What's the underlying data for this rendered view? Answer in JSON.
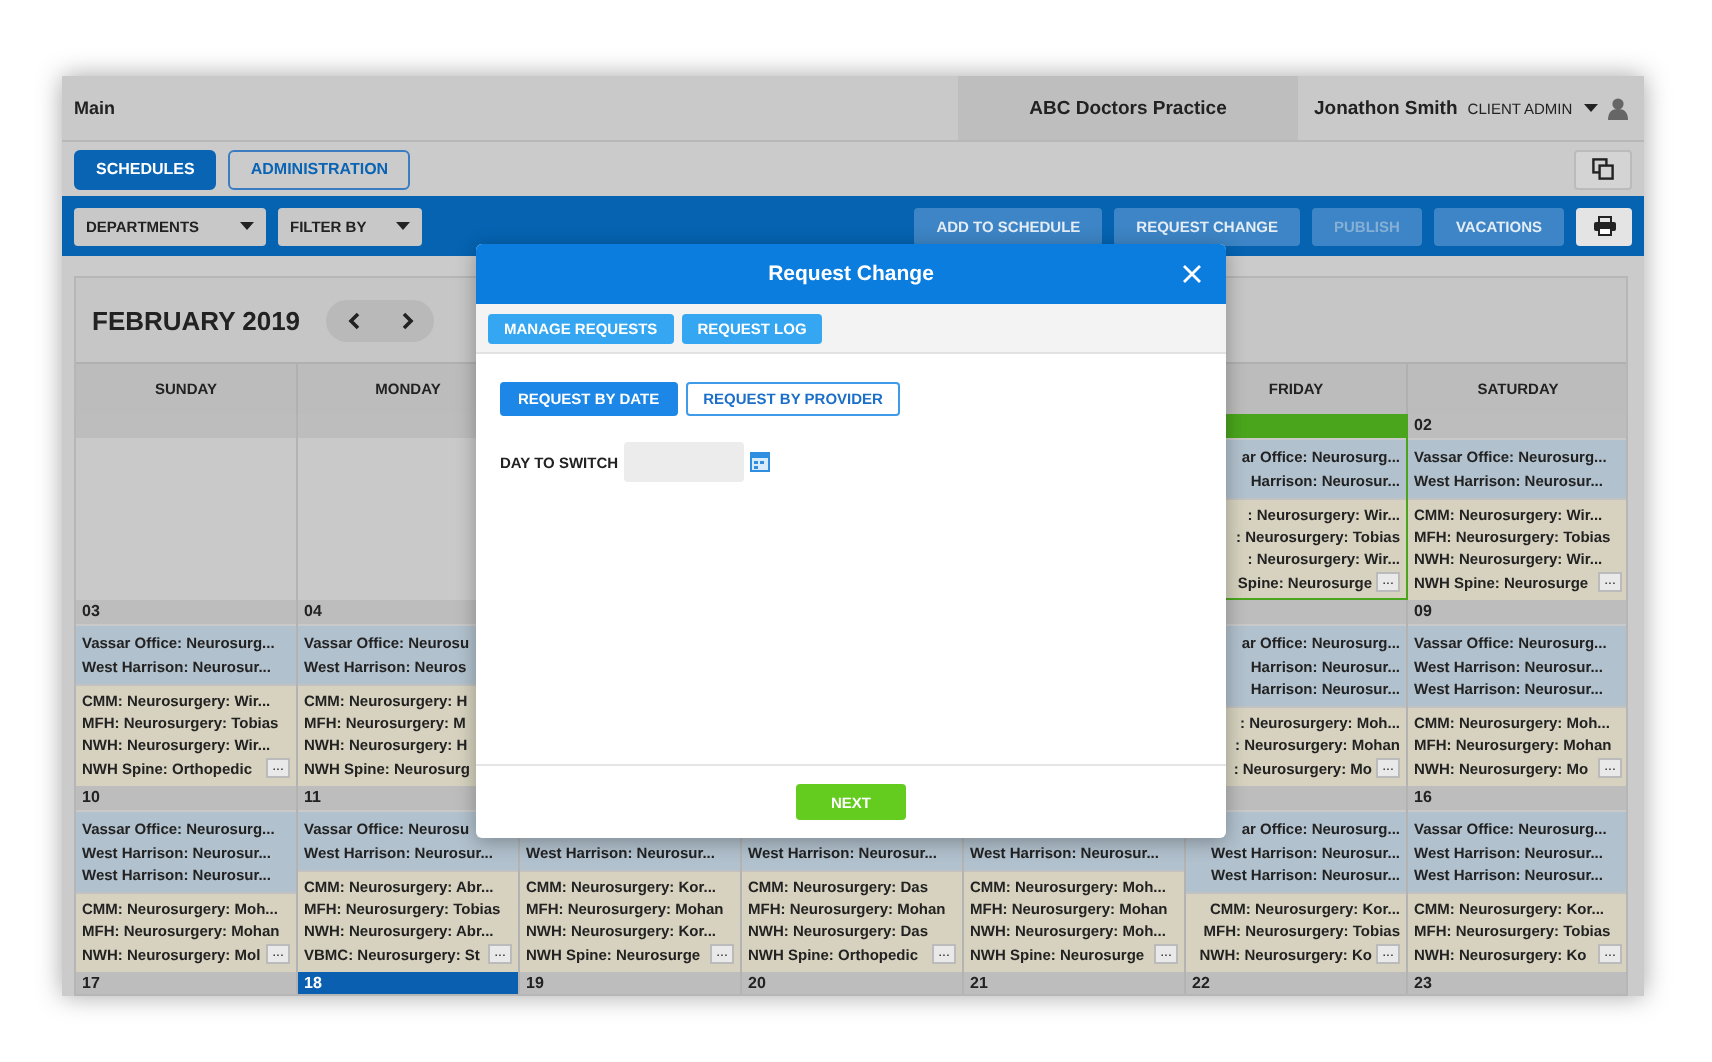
{
  "header": {
    "title": "Main",
    "practice": "ABC Doctors Practice",
    "user": "Jonathon Smith",
    "role": "CLIENT ADMIN"
  },
  "tabs": [
    {
      "label": "SCHEDULES",
      "selected": true
    },
    {
      "label": "ADMINISTRATION",
      "selected": false
    }
  ],
  "toolbar": {
    "filters": [
      "DEPARTMENTS",
      "FILTER BY"
    ],
    "actions": [
      {
        "label": "ADD TO SCHEDULE",
        "disabled": false
      },
      {
        "label": "REQUEST CHANGE",
        "disabled": false
      },
      {
        "label": "PUBLISH",
        "disabled": true
      },
      {
        "label": "VACATIONS",
        "disabled": false
      }
    ]
  },
  "calendar": {
    "month": "FEBRUARY 2019",
    "columns": [
      {
        "weekday": "SUNDAY",
        "days": [
          {
            "selected": false,
            "today": false
          },
          {
            "date": "03",
            "selected": false,
            "today": false,
            "blocks": [
              {
                "kind": "office",
                "lines": [
                  "Vassar Office: Neurosurg...",
                  "West Harrison: Neurosur..."
                ]
              },
              {
                "kind": "hospital",
                "lines": [
                  "CMM: Neurosurgery: Wir...",
                  "MFH: Neurosurgery: Tobias",
                  "NWH: Neurosurgery: Wir...",
                  "NWH Spine: Orthopedic"
                ],
                "more": "..."
              }
            ]
          },
          {
            "date": "10",
            "selected": false,
            "today": false,
            "blocks": [
              {
                "kind": "office",
                "lines": [
                  "Vassar Office: Neurosurg...",
                  "West Harrison: Neurosur...",
                  "West Harrison: Neurosur..."
                ]
              },
              {
                "kind": "hospital",
                "lines": [
                  "CMM: Neurosurgery: Moh...",
                  "MFH: Neurosurgery: Mohan",
                  "NWH: Neurosurgery: Mol"
                ],
                "more": "..."
              }
            ]
          },
          {
            "date": "17",
            "selected": false,
            "today": false
          }
        ]
      },
      {
        "weekday": "MONDAY",
        "days": [
          {
            "selected": false,
            "today": false
          },
          {
            "date": "04",
            "selected": false,
            "today": false,
            "blocks": [
              {
                "kind": "office",
                "lines": [
                  "Vassar Office: Neurosu",
                  "West Harrison: Neuros"
                ]
              },
              {
                "kind": "hospital",
                "lines": [
                  "CMM: Neurosurgery: H",
                  "MFH: Neurosurgery: M",
                  "NWH: Neurosurgery: H",
                  "NWH Spine: Neurosurg"
                ]
              }
            ]
          },
          {
            "date": "11",
            "selected": false,
            "today": false,
            "blocks": [
              {
                "kind": "office",
                "lines": [
                  "Vassar Office: Neurosu",
                  "West Harrison: Neurosur..."
                ]
              },
              {
                "kind": "hospital",
                "lines": [
                  "CMM: Neurosurgery: Abr...",
                  "MFH: Neurosurgery: Tobias",
                  "NWH: Neurosurgery: Abr...",
                  "VBMC: Neurosurgery: St"
                ],
                "more": "..."
              }
            ]
          },
          {
            "date": "18",
            "selected": false,
            "today": true
          }
        ]
      },
      {
        "days": [
          {
            "blocks": [
              {
                "kind": "office",
                "lines": [
                  "West Harrison: Neurosur..."
                ]
              },
              {
                "kind": "hospital",
                "lines": [
                  "CMM: Neurosurgery: Kor...",
                  "MFH: Neurosurgery: Mohan",
                  "NWH: Neurosurgery: Kor...",
                  "NWH Spine: Neurosurge"
                ],
                "more": "..."
              }
            ]
          },
          {
            "date": "19",
            "selected": false,
            "today": false
          }
        ]
      },
      {
        "days": [
          {
            "blocks": [
              {
                "kind": "office",
                "lines": [
                  "West Harrison: Neurosur..."
                ]
              },
              {
                "kind": "hospital",
                "lines": [
                  "CMM: Neurosurgery: Das",
                  "MFH: Neurosurgery: Mohan",
                  "NWH: Neurosurgery: Das",
                  "NWH Spine: Orthopedic"
                ],
                "more": "..."
              }
            ]
          },
          {
            "date": "20",
            "selected": false,
            "today": false
          }
        ]
      },
      {
        "days": [
          {
            "blocks": [
              {
                "kind": "office",
                "lines": [
                  "West Harrison: Neurosur..."
                ]
              },
              {
                "kind": "hospital",
                "lines": [
                  "CMM: Neurosurgery: Moh...",
                  "MFH: Neurosurgery: Mohan",
                  "NWH: Neurosurgery: Moh...",
                  "NWH Spine: Neurosurge"
                ],
                "more": "..."
              }
            ]
          },
          {
            "date": "21",
            "selected": false,
            "today": false
          }
        ]
      },
      {
        "weekday": "FRIDAY",
        "days": [
          {
            "selected": true,
            "today": false,
            "blocks": [
              {
                "kind": "office",
                "lines": [
                  "ar Office: Neurosurg...",
                  "Harrison: Neurosur..."
                ]
              },
              {
                "kind": "hospital",
                "lines": [
                  ": Neurosurgery: Wir...",
                  ": Neurosurgery: Tobias",
                  ": Neurosurgery: Wir...",
                  "Spine: Neurosurge"
                ],
                "more": "..."
              }
            ]
          },
          {
            "selected": false,
            "today": false,
            "blocks": [
              {
                "kind": "office",
                "lines": [
                  "ar Office: Neurosurg...",
                  "Harrison: Neurosur...",
                  "Harrison: Neurosur..."
                ]
              },
              {
                "kind": "hospital",
                "lines": [
                  ": Neurosurgery: Moh...",
                  ": Neurosurgery: Mohan",
                  ": Neurosurgery: Mo"
                ],
                "more": "..."
              }
            ]
          },
          {
            "selected": false,
            "today": false,
            "blocks": [
              {
                "kind": "office",
                "lines": [
                  "ar Office: Neurosurg...",
                  "West Harrison: Neurosur...",
                  "West Harrison: Neurosur..."
                ]
              },
              {
                "kind": "hospital",
                "lines": [
                  "CMM: Neurosurgery: Kor...",
                  "MFH: Neurosurgery: Tobias",
                  "NWH: Neurosurgery: Ko"
                ],
                "more": "..."
              }
            ]
          },
          {
            "date": "22",
            "selected": false,
            "today": false
          }
        ]
      },
      {
        "weekday": "SATURDAY",
        "days": [
          {
            "date": "02",
            "selected": false,
            "today": false,
            "blocks": [
              {
                "kind": "office",
                "lines": [
                  "Vassar Office: Neurosurg...",
                  "West Harrison: Neurosur..."
                ]
              },
              {
                "kind": "hospital",
                "lines": [
                  "CMM: Neurosurgery: Wir...",
                  "MFH: Neurosurgery: Tobias",
                  "NWH: Neurosurgery: Wir...",
                  "NWH Spine: Neurosurge"
                ],
                "more": "..."
              }
            ]
          },
          {
            "date": "09",
            "selected": false,
            "today": false,
            "blocks": [
              {
                "kind": "office",
                "lines": [
                  "Vassar Office: Neurosurg...",
                  "West Harrison: Neurosur...",
                  "West Harrison: Neurosur..."
                ]
              },
              {
                "kind": "hospital",
                "lines": [
                  "CMM: Neurosurgery: Moh...",
                  "MFH: Neurosurgery: Mohan",
                  "NWH: Neurosurgery: Mo"
                ],
                "more": "..."
              }
            ]
          },
          {
            "date": "16",
            "selected": false,
            "today": false,
            "blocks": [
              {
                "kind": "office",
                "lines": [
                  "Vassar Office: Neurosurg...",
                  "West Harrison: Neurosur...",
                  "West Harrison: Neurosur..."
                ]
              },
              {
                "kind": "hospital",
                "lines": [
                  "CMM: Neurosurgery: Kor...",
                  "MFH: Neurosurgery: Tobias",
                  "NWH: Neurosurgery: Ko"
                ],
                "more": "..."
              }
            ]
          },
          {
            "date": "23",
            "selected": false,
            "today": false
          }
        ]
      }
    ]
  },
  "modal": {
    "title": "Request Change",
    "menu": [
      "MANAGE REQUESTS",
      "REQUEST LOG"
    ],
    "modes": [
      {
        "label": "REQUEST BY DATE",
        "selected": true
      },
      {
        "label": "REQUEST BY PROVIDER",
        "selected": false
      }
    ],
    "field": {
      "label": "DAY TO SWITCH"
    },
    "next": "NEXT"
  }
}
